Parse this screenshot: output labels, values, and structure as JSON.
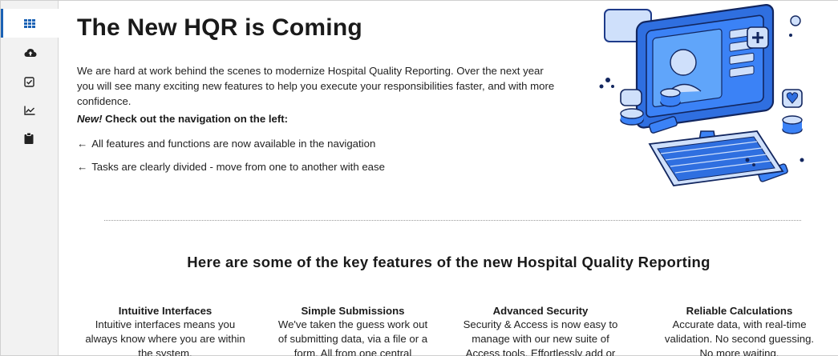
{
  "sidebar": {
    "items": [
      {
        "name": "dashboard-grid-icon",
        "active": true
      },
      {
        "name": "cloud-upload-icon",
        "active": false
      },
      {
        "name": "checkbox-icon",
        "active": false
      },
      {
        "name": "chart-icon",
        "active": false
      },
      {
        "name": "clipboard-icon",
        "active": false
      }
    ]
  },
  "main": {
    "title": "The New HQR is Coming",
    "intro": "We are hard at work behind the scenes to modernize Hospital Quality Reporting. Over the next year you will see many exciting new features to help you execute your responsibilities faster, and with more confidence.",
    "nav_heading_new": "New!",
    "nav_heading_rest": " Check out the navigation on the left:",
    "bullets": [
      {
        "arrow": "←",
        "text": "All features and functions are now available in the navigation"
      },
      {
        "arrow": "←",
        "text": "Tasks are clearly divided - move from one to another with ease"
      }
    ]
  },
  "features": {
    "heading": "Here are some of the key features of the new Hospital Quality Reporting",
    "items": [
      {
        "title": "Intuitive Interfaces",
        "desc": "Intuitive interfaces means you always know where you are within the system."
      },
      {
        "title": "Simple Submissions",
        "desc": "We've taken the guess work out of submitting data, via a file or a form. All from one central"
      },
      {
        "title": "Advanced Security",
        "desc": "Security & Access is now easy to manage with our new suite of Access tools. Effortlessly add or"
      },
      {
        "title": "Reliable Calculations",
        "desc": "Accurate data, with real-time validation. No second guessing. No more waiting."
      }
    ]
  },
  "colors": {
    "accent": "#1b62b5",
    "illustration_blue": "#2f6fe0",
    "illustration_light": "#cfe0fb"
  }
}
